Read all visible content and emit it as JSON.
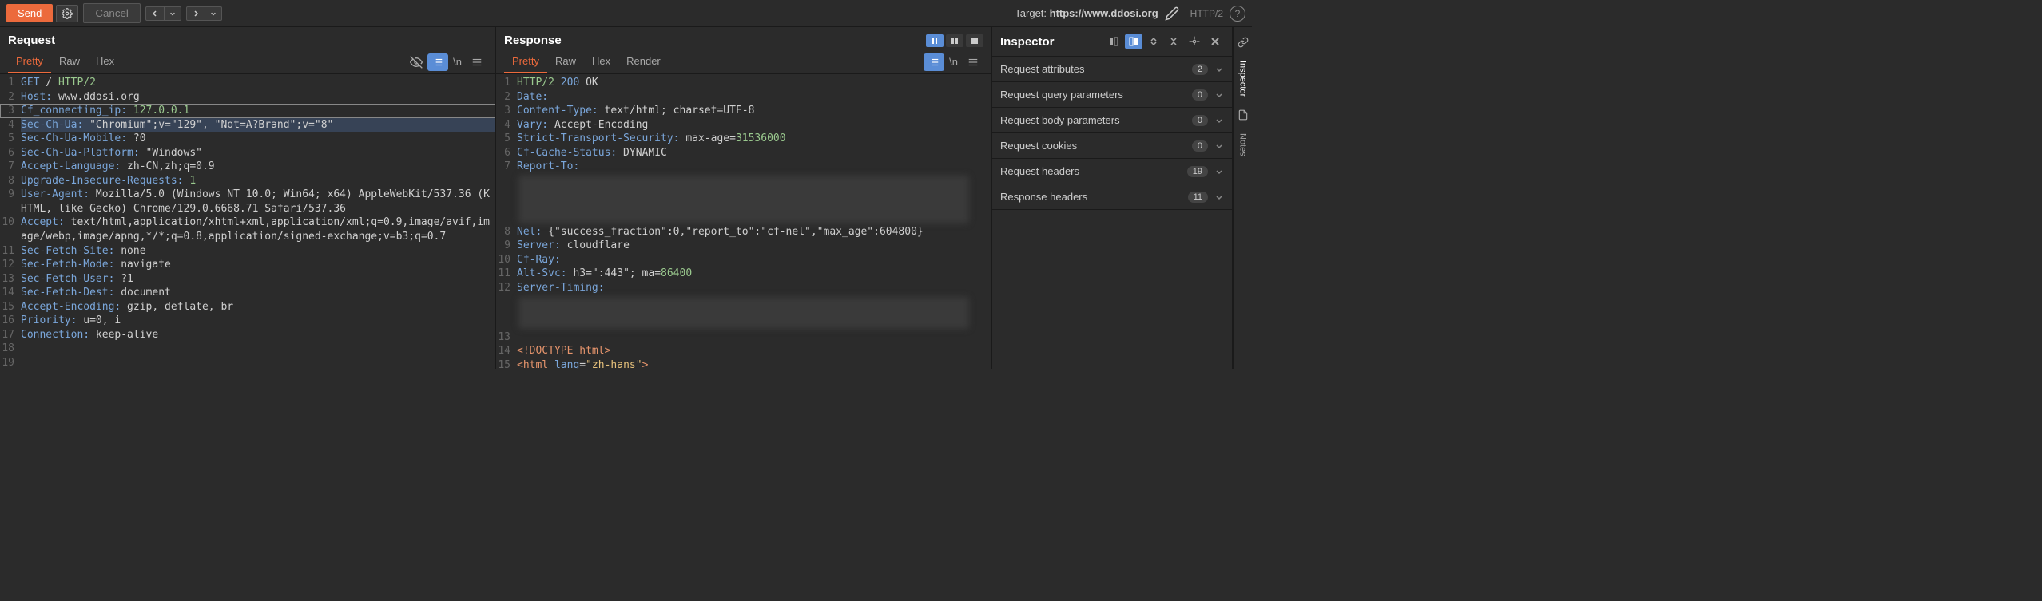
{
  "toolbar": {
    "send": "Send",
    "cancel": "Cancel",
    "target_prefix": "Target: ",
    "target_url": "https://www.ddosi.org",
    "protocol": "HTTP/2"
  },
  "request": {
    "title": "Request",
    "tabs": [
      "Pretty",
      "Raw",
      "Hex"
    ],
    "active_tab": 0,
    "lines": [
      {
        "n": 1,
        "segments": [
          {
            "t": "GET",
            "c": "hl-blue"
          },
          {
            "t": " / ",
            "c": ""
          },
          {
            "t": "HTTP/2",
            "c": "hl-green"
          }
        ]
      },
      {
        "n": 2,
        "segments": [
          {
            "t": "Host:",
            "c": "hl-blue"
          },
          {
            "t": " www.ddosi.org",
            "c": ""
          }
        ]
      },
      {
        "n": 3,
        "boxed": true,
        "segments": [
          {
            "t": "Cf_connecting_ip:",
            "c": "hl-blue"
          },
          {
            "t": " ",
            "c": ""
          },
          {
            "t": "127.0.0.1",
            "c": "hl-green"
          }
        ]
      },
      {
        "n": 4,
        "selected": true,
        "segments": [
          {
            "t": "Sec-Ch-Ua:",
            "c": "hl-blue"
          },
          {
            "t": " \"Chromium\";v=\"129\", \"Not=A?Brand\";v=\"8\"",
            "c": ""
          }
        ]
      },
      {
        "n": 5,
        "segments": [
          {
            "t": "Sec-Ch-Ua-Mobile:",
            "c": "hl-blue"
          },
          {
            "t": " ?0",
            "c": ""
          }
        ]
      },
      {
        "n": 6,
        "segments": [
          {
            "t": "Sec-Ch-Ua-Platform:",
            "c": "hl-blue"
          },
          {
            "t": " \"Windows\"",
            "c": ""
          }
        ]
      },
      {
        "n": 7,
        "segments": [
          {
            "t": "Accept-Language:",
            "c": "hl-blue"
          },
          {
            "t": " zh-CN,zh;q=0.9",
            "c": ""
          }
        ]
      },
      {
        "n": 8,
        "segments": [
          {
            "t": "Upgrade-Insecure-Requests:",
            "c": "hl-blue"
          },
          {
            "t": " ",
            "c": ""
          },
          {
            "t": "1",
            "c": "hl-green"
          }
        ]
      },
      {
        "n": 9,
        "segments": [
          {
            "t": "User-Agent:",
            "c": "hl-blue"
          },
          {
            "t": " Mozilla/5.0 (Windows NT 10.0; Win64; x64) AppleWebKit/537.36 (KHTML, like Gecko) Chrome/129.0.6668.71 Safari/537.36",
            "c": ""
          }
        ]
      },
      {
        "n": 10,
        "segments": [
          {
            "t": "Accept:",
            "c": "hl-blue"
          },
          {
            "t": " text/html,application/xhtml+xml,application/xml;q=0.9,image/avif,image/webp,image/apng,*/*;q=0.8,application/signed-exchange;v=b3;q=0.7",
            "c": ""
          }
        ]
      },
      {
        "n": 11,
        "segments": [
          {
            "t": "Sec-Fetch-Site:",
            "c": "hl-blue"
          },
          {
            "t": " none",
            "c": ""
          }
        ]
      },
      {
        "n": 12,
        "segments": [
          {
            "t": "Sec-Fetch-Mode:",
            "c": "hl-blue"
          },
          {
            "t": " navigate",
            "c": ""
          }
        ]
      },
      {
        "n": 13,
        "segments": [
          {
            "t": "Sec-Fetch-User:",
            "c": "hl-blue"
          },
          {
            "t": " ?1",
            "c": ""
          }
        ]
      },
      {
        "n": 14,
        "segments": [
          {
            "t": "Sec-Fetch-Dest:",
            "c": "hl-blue"
          },
          {
            "t": " document",
            "c": ""
          }
        ]
      },
      {
        "n": 15,
        "segments": [
          {
            "t": "Accept-Encoding:",
            "c": "hl-blue"
          },
          {
            "t": " gzip, deflate, br",
            "c": ""
          }
        ]
      },
      {
        "n": 16,
        "segments": [
          {
            "t": "Priority:",
            "c": "hl-blue"
          },
          {
            "t": " u=0, i",
            "c": ""
          }
        ]
      },
      {
        "n": 17,
        "segments": [
          {
            "t": "Connection:",
            "c": "hl-blue"
          },
          {
            "t": " keep-alive",
            "c": ""
          }
        ]
      },
      {
        "n": 18,
        "segments": [
          {
            "t": "",
            "c": ""
          }
        ]
      },
      {
        "n": 19,
        "segments": [
          {
            "t": "",
            "c": ""
          }
        ]
      }
    ]
  },
  "response": {
    "title": "Response",
    "tabs": [
      "Pretty",
      "Raw",
      "Hex",
      "Render"
    ],
    "active_tab": 0,
    "lines_a": [
      {
        "n": 1,
        "segments": [
          {
            "t": "HTTP/2",
            "c": "hl-green"
          },
          {
            "t": " ",
            "c": ""
          },
          {
            "t": "200",
            "c": "hl-blue"
          },
          {
            "t": " OK",
            "c": ""
          }
        ]
      },
      {
        "n": 2,
        "segments": [
          {
            "t": "Date:",
            "c": "hl-blue"
          },
          {
            "t": "",
            "c": ""
          }
        ]
      },
      {
        "n": 3,
        "segments": [
          {
            "t": "Content-Type:",
            "c": "hl-blue"
          },
          {
            "t": " text/html; charset=UTF-8",
            "c": ""
          }
        ]
      },
      {
        "n": 4,
        "segments": [
          {
            "t": "Vary:",
            "c": "hl-blue"
          },
          {
            "t": " Accept-Encoding",
            "c": ""
          }
        ]
      },
      {
        "n": 5,
        "segments": [
          {
            "t": "Strict-Transport-Security:",
            "c": "hl-blue"
          },
          {
            "t": " max-age=",
            "c": ""
          },
          {
            "t": "31536000",
            "c": "hl-green"
          }
        ]
      },
      {
        "n": 6,
        "segments": [
          {
            "t": "Cf-Cache-Status:",
            "c": "hl-blue"
          },
          {
            "t": " DYNAMIC",
            "c": ""
          }
        ]
      },
      {
        "n": 7,
        "segments": [
          {
            "t": "Report-To:",
            "c": "hl-blue"
          },
          {
            "t": "",
            "c": ""
          }
        ]
      }
    ],
    "lines_b": [
      {
        "n": 8,
        "segments": [
          {
            "t": "Nel:",
            "c": "hl-blue"
          },
          {
            "t": " {\"success_fraction\":0,\"report_to\":\"cf-nel\",\"max_age\":604800}",
            "c": ""
          }
        ]
      },
      {
        "n": 9,
        "segments": [
          {
            "t": "Server:",
            "c": "hl-blue"
          },
          {
            "t": " cloudflare",
            "c": ""
          }
        ]
      },
      {
        "n": 10,
        "segments": [
          {
            "t": "Cf-Ray:",
            "c": "hl-blue"
          },
          {
            "t": "",
            "c": ""
          }
        ]
      },
      {
        "n": 11,
        "segments": [
          {
            "t": "Alt-Svc:",
            "c": "hl-blue"
          },
          {
            "t": " h3=\":443\"; ma=",
            "c": ""
          },
          {
            "t": "86400",
            "c": "hl-green"
          }
        ]
      },
      {
        "n": 12,
        "segments": [
          {
            "t": "Server-Timing:",
            "c": "hl-blue"
          },
          {
            "t": "",
            "c": ""
          }
        ]
      }
    ],
    "lines_c": [
      {
        "n": 13,
        "segments": [
          {
            "t": "",
            "c": ""
          }
        ]
      },
      {
        "n": 14,
        "segments": [
          {
            "t": "<!DOCTYPE html>",
            "c": "hl-orange"
          }
        ]
      },
      {
        "n": 15,
        "segments": [
          {
            "t": "<html",
            "c": "hl-orange"
          },
          {
            "t": " ",
            "c": ""
          },
          {
            "t": "lang",
            "c": "hl-blue"
          },
          {
            "t": "=",
            "c": ""
          },
          {
            "t": "\"zh-hans\"",
            "c": "hl-yellow"
          },
          {
            "t": ">",
            "c": "hl-orange"
          }
        ]
      }
    ]
  },
  "inspector": {
    "title": "Inspector",
    "sections": [
      {
        "label": "Request attributes",
        "count": "2"
      },
      {
        "label": "Request query parameters",
        "count": "0"
      },
      {
        "label": "Request body parameters",
        "count": "0"
      },
      {
        "label": "Request cookies",
        "count": "0"
      },
      {
        "label": "Request headers",
        "count": "19"
      },
      {
        "label": "Response headers",
        "count": "11"
      }
    ]
  },
  "sidetabs": {
    "inspector": "Inspector",
    "notes": "Notes"
  }
}
